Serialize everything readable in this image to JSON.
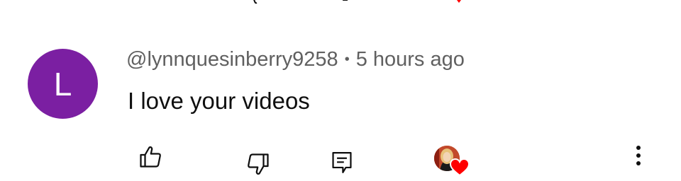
{
  "comment": {
    "avatar_letter": "L",
    "avatar_color": "#7B1FA2",
    "username": "@lynnquesinberry9258",
    "separator": "•",
    "time_ago": "5 hours ago",
    "text": "I love your videos"
  },
  "actions": {
    "like_icon": "thumbs-up-icon",
    "dislike_icon": "thumbs-down-icon",
    "reply_icon": "reply-comment-icon",
    "creator_heart_icon": "creator-heart-icon",
    "more_icon": "more-vertical-icon",
    "heart_color": "#FF0000"
  }
}
